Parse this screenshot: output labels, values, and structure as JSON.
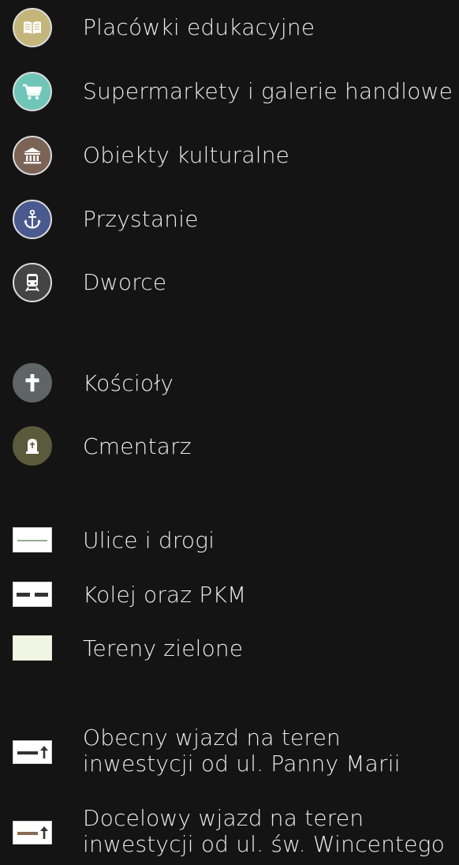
{
  "colors": {
    "background": "#141414",
    "education": "#c4b57a",
    "shopping": "#6fc6b8",
    "culture": "#7b6356",
    "marina": "#4a5a8e",
    "station": "#444444",
    "church": "#5f6566",
    "cemetery": "#5b5a3c",
    "road_line": "#8fae8a",
    "rail_dash": "#333333",
    "green_area": "#f0f5e4",
    "current_entry": "#333333",
    "target_entry": "#8a6a52"
  },
  "legend": [
    {
      "label": "Placówki edukacyjne",
      "icon": "book-icon"
    },
    {
      "label": "Supermarkety i galerie handlowe",
      "icon": "cart-icon"
    },
    {
      "label": "Obiekty kulturalne",
      "icon": "museum-icon"
    },
    {
      "label": "Przystanie",
      "icon": "anchor-icon"
    },
    {
      "label": "Dworce",
      "icon": "train-icon"
    },
    {
      "label": "Kościoły",
      "icon": "cross-icon"
    },
    {
      "label": "Cmentarz",
      "icon": "grave-icon"
    },
    {
      "label": "Ulice i drogi",
      "icon": "road-swatch"
    },
    {
      "label": "Kolej oraz PKM",
      "icon": "rail-swatch"
    },
    {
      "label": "Tereny zielone",
      "icon": "green-swatch"
    },
    {
      "label_lines": [
        "Obecny wjazd na teren",
        "inwestycji od ul. Panny Marii"
      ],
      "icon": "entry-arrow-icon"
    },
    {
      "label_lines": [
        "Docelowy wjazd na teren",
        "inwestycji od ul. św. Wincentego"
      ],
      "icon": "entry-arrow-icon"
    }
  ]
}
